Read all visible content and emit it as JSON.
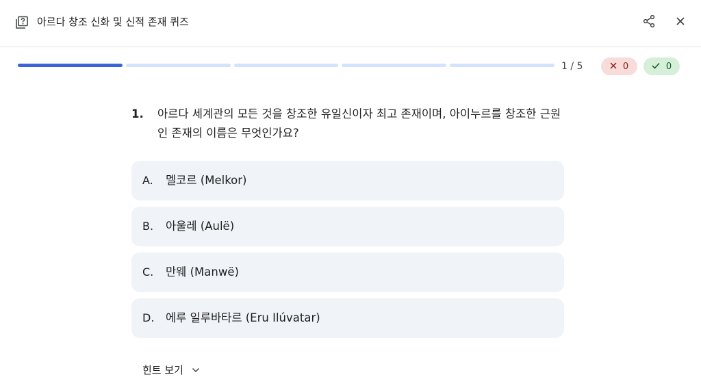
{
  "header": {
    "title": "아르다 창조 신화 및 신적 존재 퀴즈",
    "icon": "quiz-icon",
    "actions": [
      "share-icon",
      "close-icon"
    ]
  },
  "progress": {
    "current": 1,
    "total": 5,
    "counter_text": "1 / 5",
    "wrong_count": "0",
    "correct_count": "0"
  },
  "question": {
    "number": "1.",
    "text": "아르다 세계관의 모든 것을 창조한 유일신이자 최고 존재이며, 아이누르를 창조한 근원인 존재의 이름은 무엇인가요?"
  },
  "options": [
    {
      "letter": "A.",
      "text": "멜코르 (Melkor)"
    },
    {
      "letter": "B.",
      "text": "아울레 (Aulë)"
    },
    {
      "letter": "C.",
      "text": "만웨 (Manwë)"
    },
    {
      "letter": "D.",
      "text": "에루 일루바타르 (Eru Ilúvatar)"
    }
  ],
  "hint": {
    "label": "힌트 보기",
    "icon": "chevron-down-icon"
  },
  "colors": {
    "accent": "#3a64d8",
    "progress_track": "#d3e3fd",
    "option_bg": "#f0f4f9",
    "wrong_bg": "#f8dcd9",
    "correct_bg": "#d5efd9"
  }
}
